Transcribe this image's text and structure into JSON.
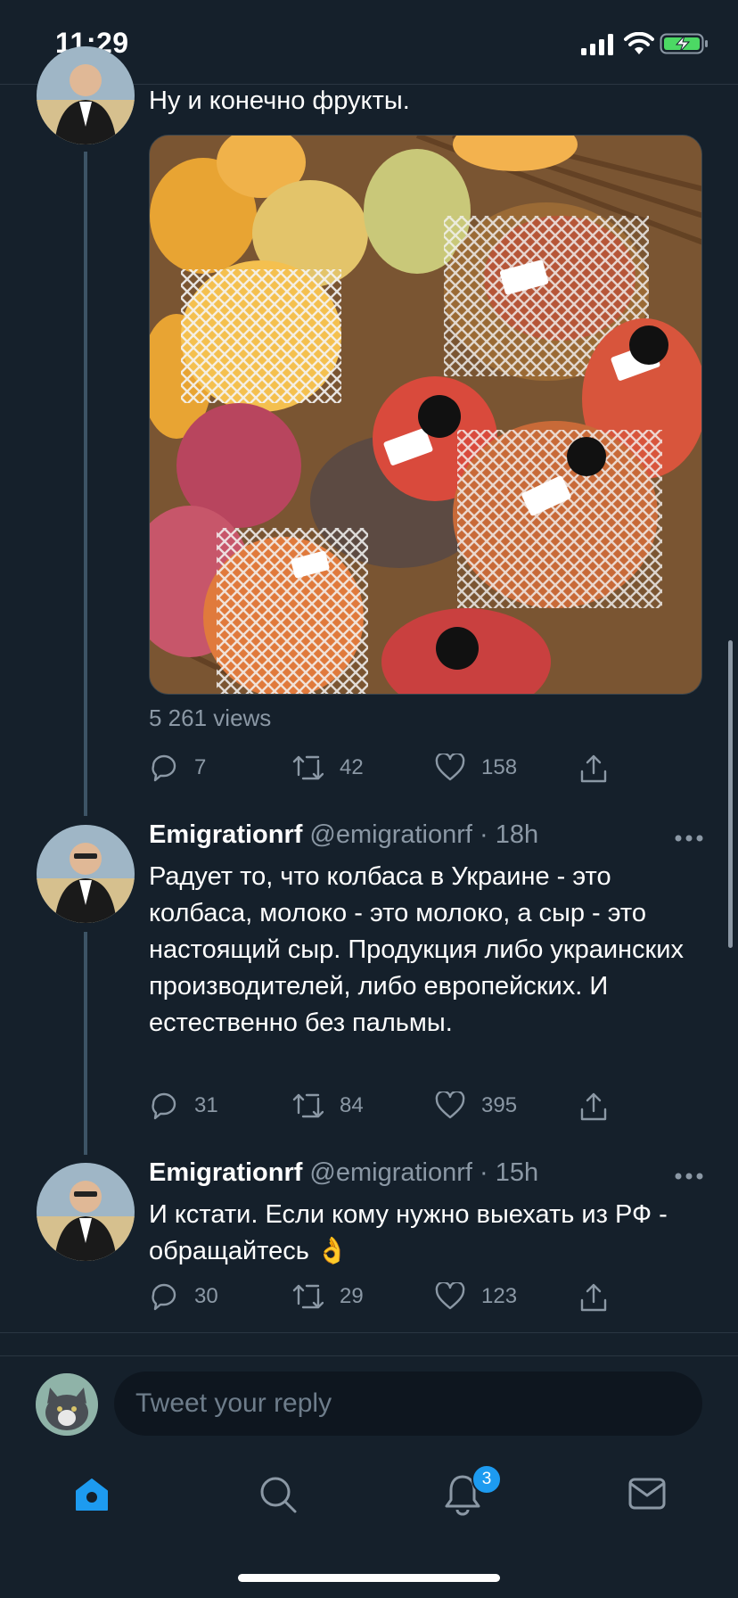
{
  "status_bar": {
    "time": "11:29"
  },
  "tweets": [
    {
      "text": "Ну и конечно фрукты.",
      "views": "5 261 views",
      "replies": "7",
      "retweets": "42",
      "likes": "158"
    },
    {
      "display_name": "Emigrationrf",
      "handle": "@emigrationrf · 18h",
      "text": "Радует то, что колбаса в Украине - это колбаса, молоко - это молоко, а сыр - это настоящий сыр. Продукция либо украинских производителей, либо европейских. И естественно без пальмы.",
      "replies": "31",
      "retweets": "84",
      "likes": "395"
    },
    {
      "display_name": "Emigrationrf",
      "handle": "@emigrationrf · 15h",
      "text": "И кстати. Если кому нужно выехать из РФ - обращайтесь 👌",
      "replies": "30",
      "retweets": "29",
      "likes": "123"
    }
  ],
  "reply": {
    "placeholder": "Tweet your reply"
  },
  "tab_bar": {
    "notifications_badge": "3"
  },
  "colors": {
    "background": "#15202b",
    "accent": "#1d9bf0",
    "secondary_text": "#8b98a5"
  }
}
